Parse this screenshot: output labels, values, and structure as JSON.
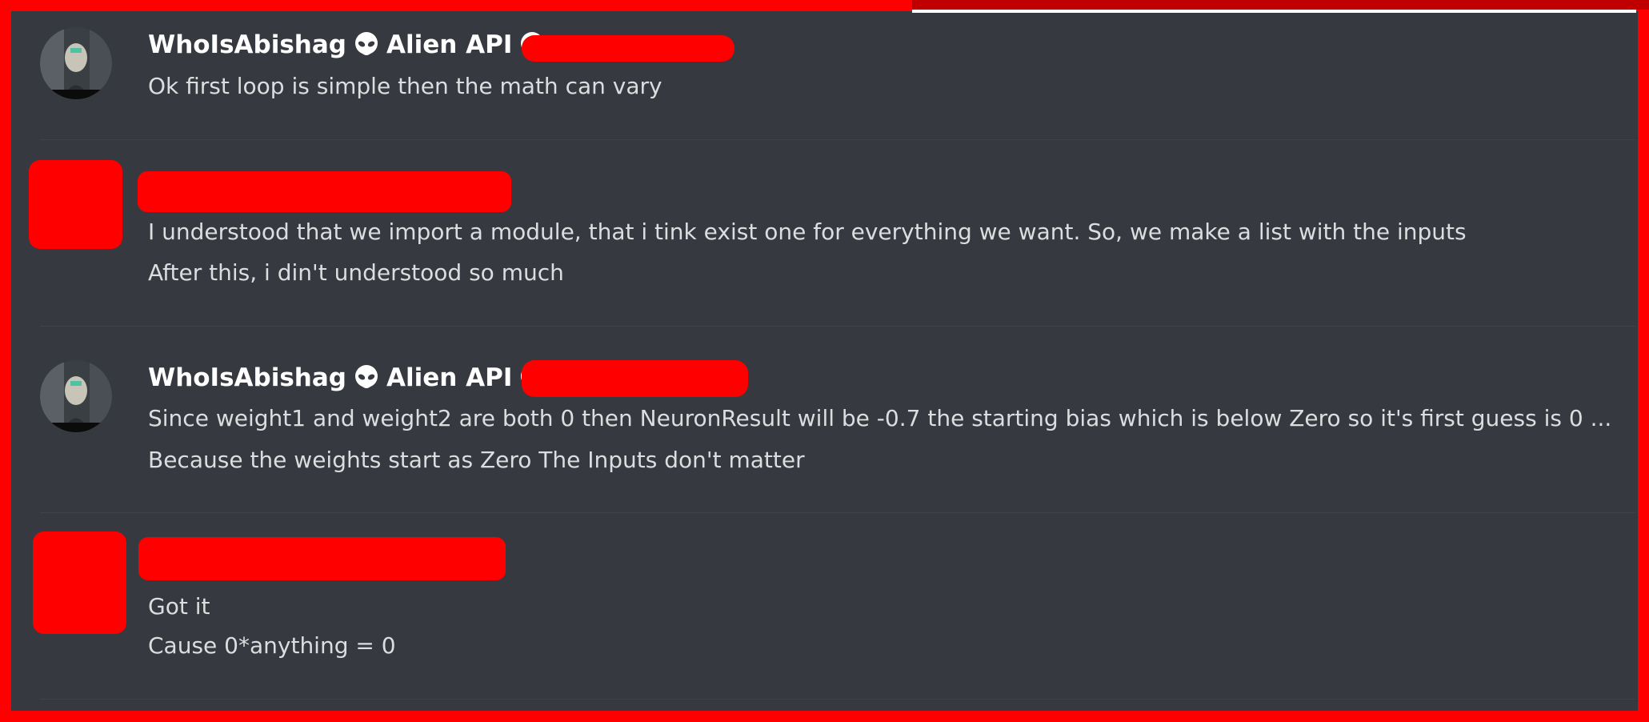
{
  "messages": [
    {
      "author": "WhoIsAbishag",
      "tag": "Alien API",
      "lines": [
        "Ok first loop is simple then the math can vary"
      ]
    },
    {
      "author": "",
      "lines": [
        "I understood that we import a module, that i tink exist one for everything we want. So, we make a list with the inputs",
        "After this, i din't understood so much"
      ]
    },
    {
      "author": "WhoIsAbishag",
      "tag": "Alien API",
      "lines": [
        "Since weight1 and weight2 are both 0 then NeuronResult will be -0.7 the starting bias which is below Zero so it's first guess is 0 ...",
        "Because the weights start as Zero The Inputs don't matter"
      ]
    },
    {
      "author": "",
      "lines": [
        "Got it",
        "Cause 0*anything = 0"
      ]
    }
  ],
  "colors": {
    "background": "#36393f",
    "frame": "#ff0000",
    "author_text": "#ffffff",
    "message_text": "#dcddde",
    "redaction": "#ff0000"
  },
  "icons": [
    "alien-icon"
  ]
}
